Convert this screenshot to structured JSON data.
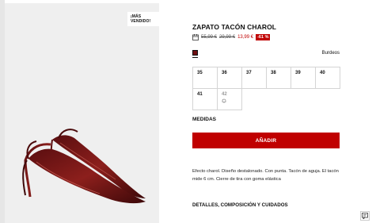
{
  "product": {
    "badge": "¡MÁS VENDIDO!",
    "title": "ZAPATO TACÓN CHAROL",
    "price_original": "55,99 €",
    "price_previous": "29,99 €",
    "price_sale": "13,99 €",
    "discount": "-61 %",
    "color_name": "Burdeos",
    "color_hex": "#6e0f12",
    "sizes": [
      {
        "label": "35"
      },
      {
        "label": "36"
      },
      {
        "label": "37"
      },
      {
        "label": "38"
      },
      {
        "label": "39"
      },
      {
        "label": "40"
      },
      {
        "label": "41"
      },
      {
        "label": "42"
      }
    ],
    "measures_label": "MEDIDAS",
    "add_label": "AÑADIR",
    "description": "Efecto charol. Diseño destalonado. Con punta. Tacón de aguja. El tacón mide 6 cm. Cierre de tira con goma elástica",
    "details_label": "DETALLES, COMPOSICIÓN Y CUIDADOS"
  },
  "colors": {
    "accent": "#c00000",
    "swatch": "#6e0f12"
  },
  "icons": {
    "price_info": "calendar-icon",
    "notify": "bell-icon",
    "chat": "chat-icon"
  }
}
